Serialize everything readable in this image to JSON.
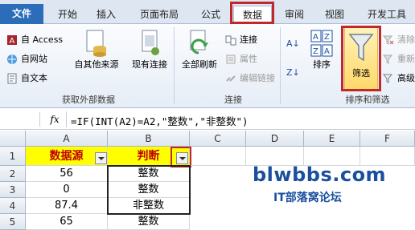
{
  "tabs": [
    "文件",
    "开始",
    "插入",
    "页面布局",
    "公式",
    "数据",
    "审阅",
    "视图",
    "开发工具"
  ],
  "active_tab": "数据",
  "ribbon": {
    "external": {
      "access": "自 Access",
      "web": "自网站",
      "text": "自文本",
      "other_sources": "自其他来源",
      "existing": "现有连接",
      "group": "获取外部数据"
    },
    "connections": {
      "refresh_all": "全部刷新",
      "connections": "连接",
      "properties": "属性",
      "edit_links": "编辑链接",
      "group": "连接"
    },
    "sort_filter": {
      "sort": "排序",
      "filter": "筛选",
      "clear": "清除",
      "reapply": "重新",
      "advanced": "高级",
      "group": "排序和筛选"
    }
  },
  "formula_bar": {
    "fx": "fx",
    "formula": "=IF(INT(A2)=A2,\"整数\",\"非整数\")"
  },
  "grid": {
    "columns": [
      "A",
      "B",
      "C",
      "D",
      "E",
      "F"
    ],
    "rows": [
      "1",
      "2",
      "3",
      "4",
      "5"
    ],
    "header": {
      "a": "数据源",
      "b": "判断"
    },
    "data": [
      {
        "a": "56",
        "b": "整数"
      },
      {
        "a": "0",
        "b": "整数"
      },
      {
        "a": "87.4",
        "b": "非整数"
      },
      {
        "a": "65",
        "b": "整数"
      }
    ]
  },
  "watermark": {
    "site": "blwbbs.com",
    "caption": "IT部落窝论坛"
  },
  "colors": {
    "highlight": "#c0282b",
    "header_fill": "#ffff00",
    "header_text": "#c00000",
    "brand": "#2b6db8"
  }
}
